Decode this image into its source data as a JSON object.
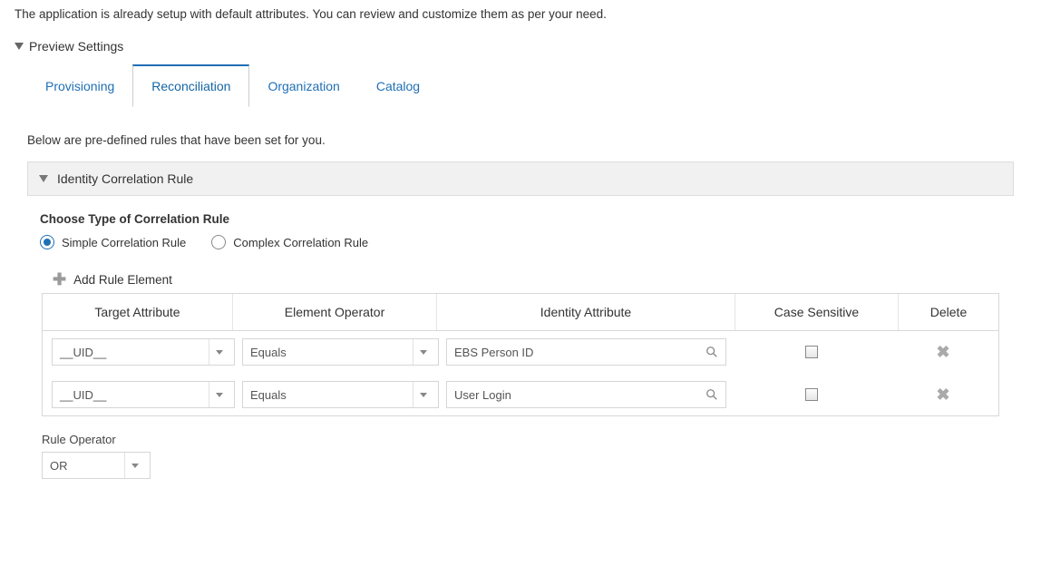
{
  "intro": "The application is already setup with default attributes. You can review and customize them as per your need.",
  "previewSettings": {
    "label": "Preview Settings"
  },
  "tabs": {
    "provisioning": "Provisioning",
    "reconciliation": "Reconciliation",
    "organization": "Organization",
    "catalog": "Catalog"
  },
  "subtext": "Below are pre-defined rules that have been set for you.",
  "panel": {
    "title": "Identity Correlation Rule"
  },
  "chooseLabel": "Choose Type of Correlation Rule",
  "radios": {
    "simple": "Simple Correlation Rule",
    "complex": "Complex Correlation Rule"
  },
  "addRuleElement": "Add Rule Element",
  "headers": {
    "target": "Target Attribute",
    "elementOp": "Element Operator",
    "identity": "Identity Attribute",
    "caseSensitive": "Case Sensitive",
    "delete": "Delete"
  },
  "rows": [
    {
      "target": "__UID__",
      "op": "Equals",
      "identity": "EBS Person ID",
      "caseSensitive": false
    },
    {
      "target": "__UID__",
      "op": "Equals",
      "identity": "User Login",
      "caseSensitive": false
    }
  ],
  "ruleOperator": {
    "label": "Rule Operator",
    "value": "OR"
  }
}
